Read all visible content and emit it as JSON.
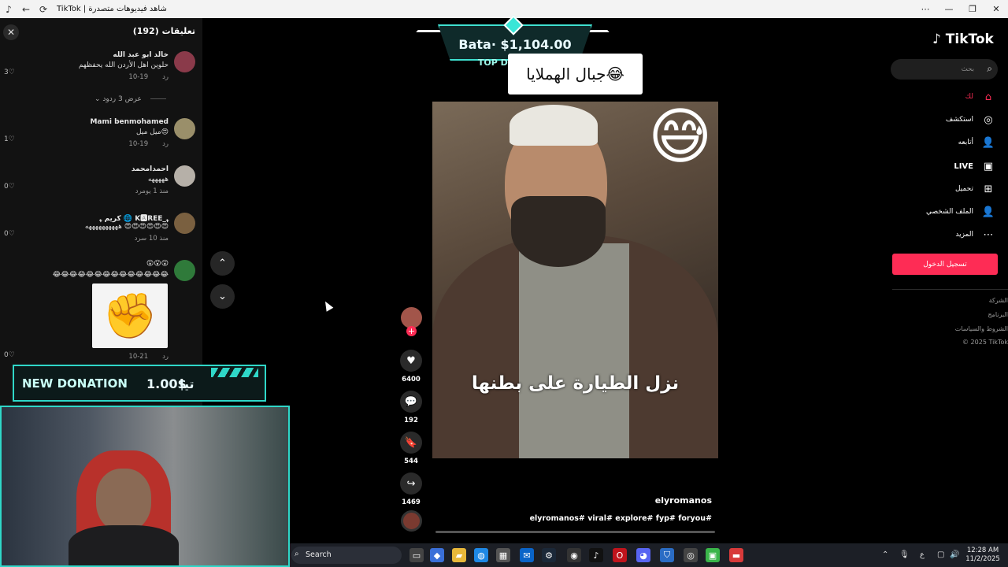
{
  "window": {
    "title": "TikTok | شاهد فيديوهات متصدرة",
    "controls": [
      "⋯",
      "—",
      "❐",
      "✕"
    ]
  },
  "comments": {
    "count_label": "تعليقات (192)",
    "items": [
      {
        "name": "خالد ابو عبد الله",
        "text": "حلوين اهل الأردن الله يحفظهم",
        "date": "10-19",
        "reply": "رد",
        "likes": "3"
      },
      {
        "name": "Mami benmohamed",
        "text": "ميل ميل😍",
        "date": "10-19",
        "reply": "رد",
        "likes": "1"
      },
      {
        "name": "احمدامحمد",
        "text": "هههههه",
        "date": "منذ 1 يوم",
        "reply": "رد",
        "likes": "0"
      },
      {
        "name": "كريم ﮩ 🌐 K🅰REE_ﮩ",
        "text": "ههههههههههه 😍😍😍😍😍😍",
        "date": "منذ 10 س",
        "reply": "رد",
        "likes": "0"
      },
      {
        "name": "😮😮😮",
        "text": "😂😂😂😂😂😂😂😂😂😂😂😂😂😂",
        "date": "10-21",
        "reply": "رد",
        "likes": "0"
      }
    ],
    "view_replies": "عرض 3 ردود"
  },
  "donation_top": {
    "amount": "Bata· $1,104.00",
    "label": "TOP DONATION"
  },
  "video": {
    "overlay_text": "جبال الهملايا😂",
    "subtitle": "نزل الطيارة على بطنها",
    "author": "elyromanos",
    "tags": "elyromanos# viral# explore# fyp# foryou#"
  },
  "actions": {
    "likes": "6400",
    "comments": "192",
    "saves": "544",
    "shares": "1469"
  },
  "sidebar": {
    "logo": "TikTok",
    "search_placeholder": "بحث",
    "items": [
      {
        "label": "لك",
        "icon": "⌂",
        "state": "active"
      },
      {
        "label": "استكشف",
        "icon": "◎",
        "state": ""
      },
      {
        "label": "أتابعه",
        "icon": "👤",
        "state": ""
      },
      {
        "label": "LIVE",
        "icon": "▣",
        "state": "bold"
      },
      {
        "label": "تحميل",
        "icon": "⊞",
        "state": ""
      },
      {
        "label": "الملف الشخصي",
        "icon": "👤",
        "state": ""
      },
      {
        "label": "المزيد",
        "icon": "⋯",
        "state": ""
      }
    ],
    "login": "تسجيل الدخول",
    "footer": [
      "الشركة",
      "البرنامج",
      "الشروط والسياسات",
      "© 2025 TikTok"
    ]
  },
  "donation_new": {
    "title": "NEW DONATION",
    "amount": "1.00$",
    "name": "تيا"
  },
  "taskbar": {
    "search_label": "Search",
    "time": "12:28 AM",
    "date": "11/2/2025"
  }
}
